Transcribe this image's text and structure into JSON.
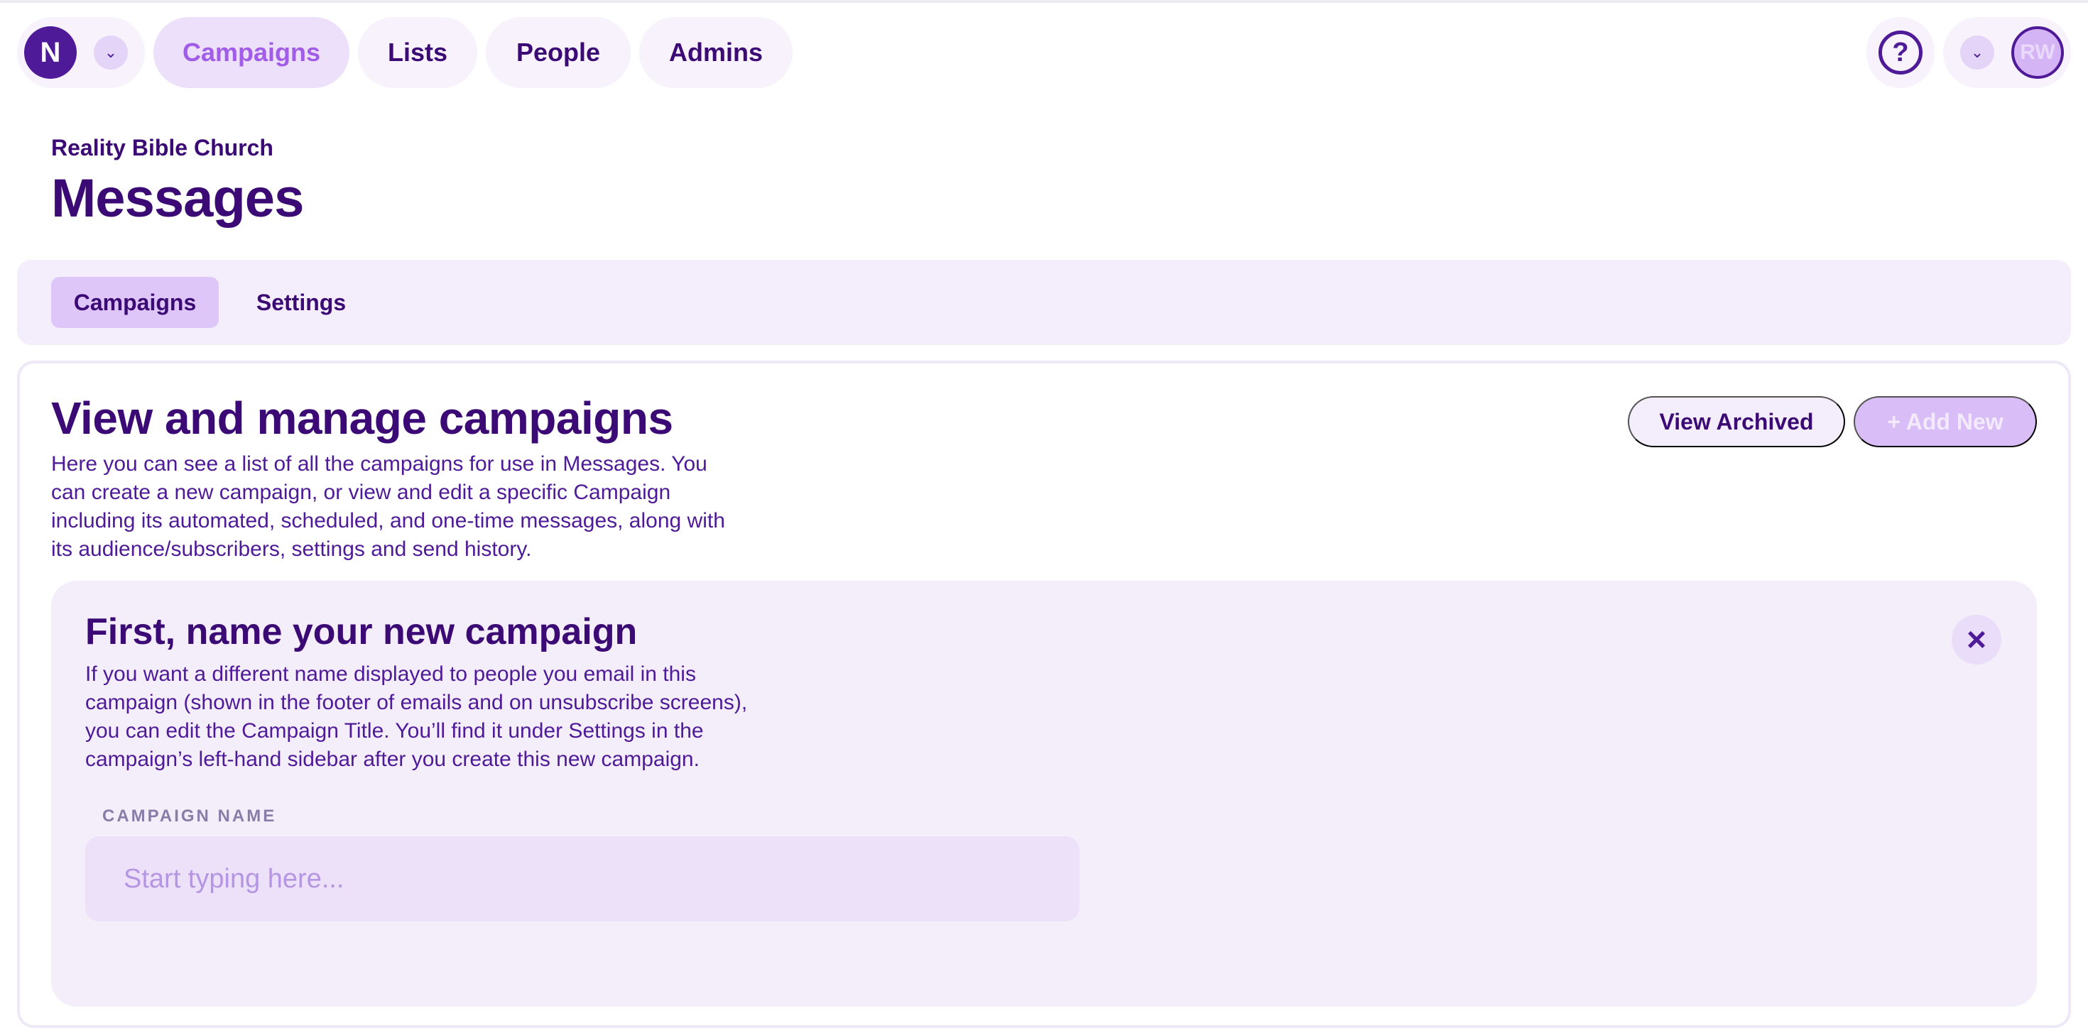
{
  "nav": {
    "brand_initial": "N",
    "items": [
      {
        "label": "Campaigns",
        "active": true
      },
      {
        "label": "Lists"
      },
      {
        "label": "People"
      },
      {
        "label": "Admins"
      }
    ],
    "help_icon": "?",
    "avatar_initials": "RW",
    "icons": {
      "chevron": "chevron-down-icon",
      "help": "help-icon"
    }
  },
  "header": {
    "org_name": "Reality Bible Church",
    "title": "Messages"
  },
  "tabs": [
    {
      "label": "Campaigns",
      "active": true
    },
    {
      "label": "Settings"
    }
  ],
  "campaigns": {
    "title": "View and manage campaigns",
    "description": "Here you can see a list of all the campaigns for use in Messages. You can create a new campaign, or view and edit a specific Campaign including its automated, scheduled, and one-time messages, along with its audience/subscribers, settings and send history.",
    "buttons": {
      "view_archived": "View Archived",
      "add_new": "+ Add New"
    }
  },
  "new_campaign": {
    "title": "First, name your new campaign",
    "description": "If you want a different name displayed to people you email in this campaign (shown in the footer of emails and on unsubscribe screens), you can edit the Campaign Title. You’ll find it under Settings in the campaign’s left-hand sidebar after you create this new campaign.",
    "field_label": "CAMPAIGN NAME",
    "placeholder": "Start typing here...",
    "value": ""
  },
  "colors": {
    "primary": "#3B0A75",
    "accent": "#A15CE8",
    "lavender_bg": "#F4EDFB"
  }
}
